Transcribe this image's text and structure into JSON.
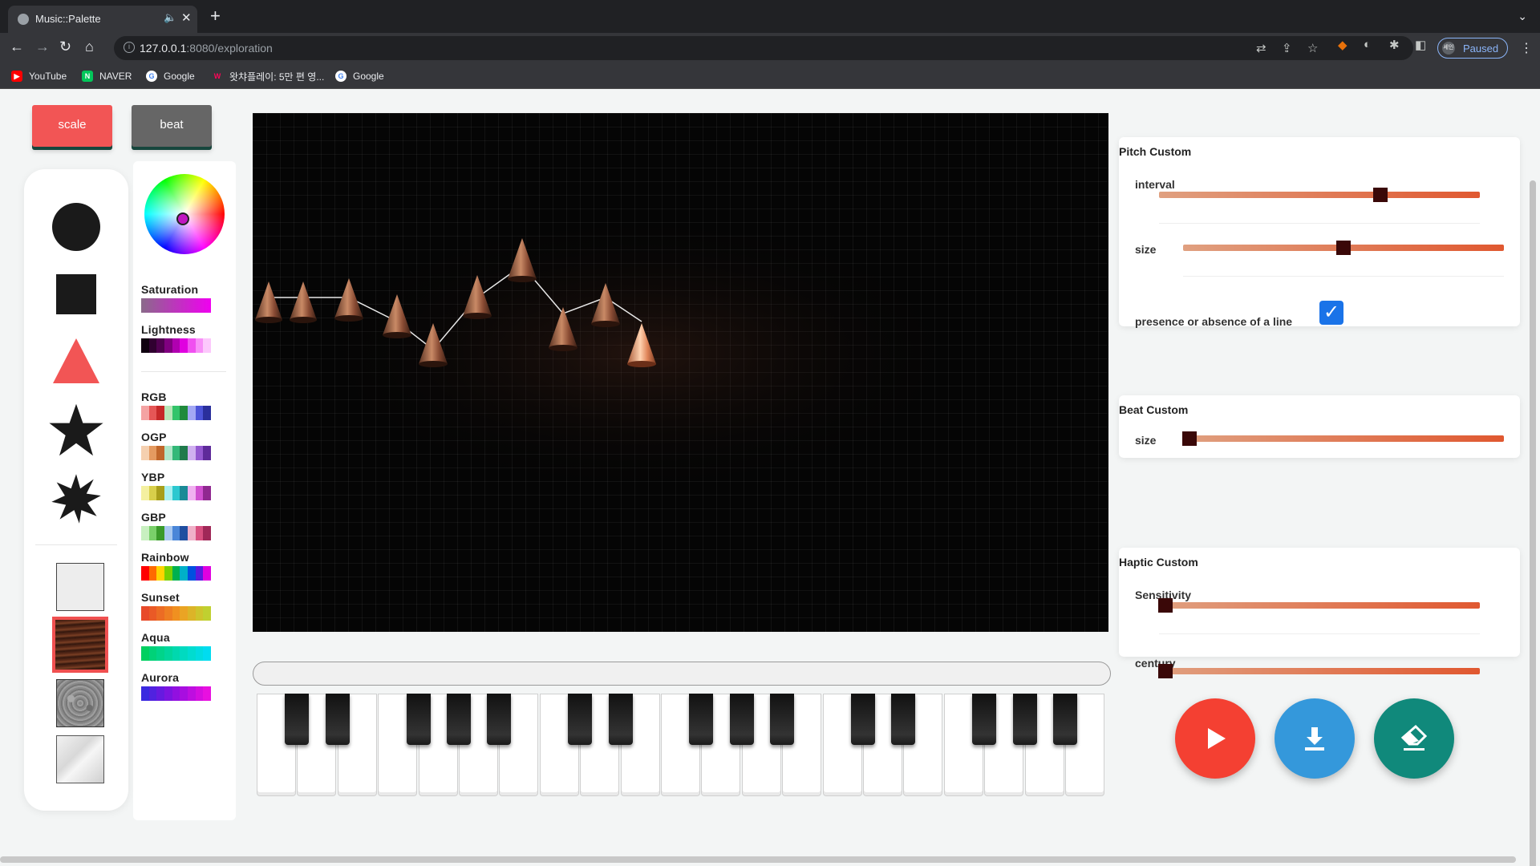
{
  "browser": {
    "tab_title": "Music::Palette",
    "audio_icon": "speaker-muted-icon",
    "close_glyph": "✕",
    "newtab_glyph": "+",
    "url_host": "127.0.0.1",
    "url_rest": ":8080/exploration",
    "profile_avatar": "세인",
    "profile_status": "Paused"
  },
  "bookmarks": [
    {
      "label": "YouTube",
      "icon": "youtube-icon",
      "color": "#ff0000"
    },
    {
      "label": "NAVER",
      "icon": "naver-icon",
      "color": "#03c75a"
    },
    {
      "label": "Google",
      "icon": "google-icon",
      "color": "#4285f4"
    },
    {
      "label": "왓챠플레이: 5만 편 영...",
      "icon": "watcha-icon",
      "color": "#ff0558"
    },
    {
      "label": "Google",
      "icon": "google-icon",
      "color": "#4285f4"
    }
  ],
  "mode_buttons": {
    "scale": "scale",
    "beat": "beat"
  },
  "colors": {
    "accent_red": "#f25555",
    "slider_thumb": "#3a0808",
    "checkbox": "#1a73e8",
    "play": "#f44032",
    "download": "#3498db",
    "erase": "#10897b"
  },
  "shapes": [
    "circle",
    "square",
    "triangle",
    "star",
    "burst"
  ],
  "textures": [
    "plain",
    "wood",
    "stone",
    "silk"
  ],
  "selected_texture": "wood",
  "palette": {
    "saturation_label": "Saturation",
    "lightness_label": "Lightness",
    "schemes": [
      {
        "label": "RGB",
        "colors": [
          "#f4a3a3",
          "#e55656",
          "#c62828",
          "#b8e6b8",
          "#33c46a",
          "#1f8a3c",
          "#a3a8f4",
          "#4c54d8",
          "#2a2f9c"
        ]
      },
      {
        "label": "OGP",
        "colors": [
          "#f5d0b0",
          "#e49a60",
          "#c0662a",
          "#b0e6c8",
          "#33b878",
          "#1f7a4c",
          "#d0b0f0",
          "#9458d0",
          "#5e2a9a"
        ]
      },
      {
        "label": "YBP",
        "colors": [
          "#f4f0a0",
          "#d8cf4a",
          "#a89e1a",
          "#a8f0f0",
          "#2cc8d0",
          "#1a8a96",
          "#f0b0f0",
          "#d050d0",
          "#902890"
        ]
      },
      {
        "label": "GBP",
        "colors": [
          "#c8f0c0",
          "#7ad06a",
          "#3a9a2a",
          "#a8c8f0",
          "#4a86d8",
          "#1f4ea0",
          "#f0b0c8",
          "#d85080",
          "#a02858"
        ]
      },
      {
        "label": "Rainbow",
        "colors": [
          "#ff0000",
          "#ff6a00",
          "#ffd400",
          "#7ad000",
          "#00b050",
          "#00b0c8",
          "#0050e0",
          "#5a1ae0",
          "#e000e0"
        ]
      },
      {
        "label": "Sunset",
        "colors": [
          "#e84a2a",
          "#ea5a26",
          "#ec6c24",
          "#ee7e22",
          "#f09020",
          "#eaa424",
          "#dcb428",
          "#cec42c",
          "#c0d030"
        ]
      },
      {
        "label": "Aqua",
        "colors": [
          "#00d060",
          "#00d278",
          "#00d48a",
          "#00d69c",
          "#00d8ae",
          "#00dac0",
          "#00dcd0",
          "#00dce0",
          "#00dcf0"
        ]
      },
      {
        "label": "Aurora",
        "colors": [
          "#3a2ae0",
          "#5022e0",
          "#661ae0",
          "#7c14e0",
          "#9210e0",
          "#a80ee0",
          "#be0ee0",
          "#d40ee0",
          "#e810e0"
        ]
      }
    ]
  },
  "pitch_custom": {
    "title": "Pitch Custom",
    "interval_label": "interval",
    "interval_value": 0.69,
    "size_label": "size",
    "size_value": 0.5,
    "line_label": "presence or absence of a line",
    "line_checked": true
  },
  "beat_custom": {
    "title": "Beat Custom",
    "size_label": "size",
    "size_value": 0.02
  },
  "haptic_custom": {
    "title": "Haptic Custom",
    "sensitivity_label": "Sensitivity",
    "sensitivity_value": 0.02,
    "century_label": "century",
    "century_value": 0.02
  },
  "actions": {
    "play": "play-icon",
    "download": "download-icon",
    "erase": "eraser-icon"
  }
}
